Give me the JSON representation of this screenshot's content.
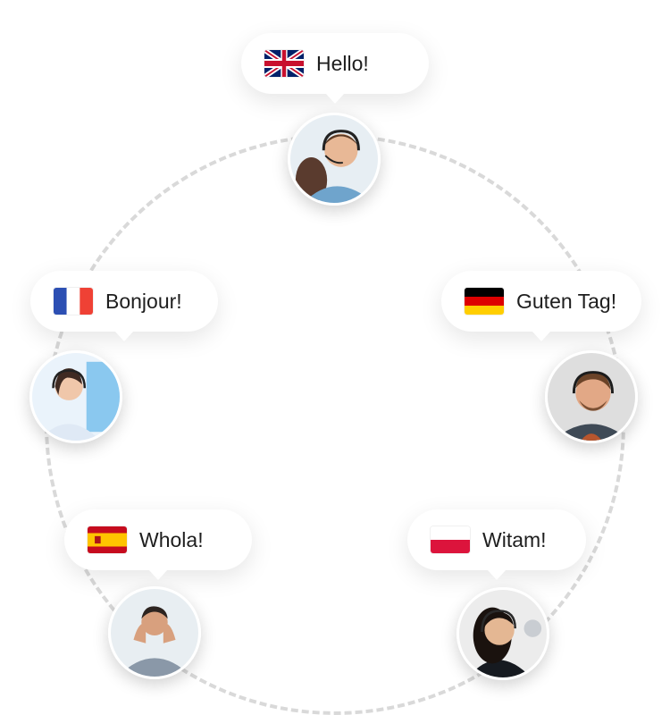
{
  "agents": [
    {
      "language": "English",
      "greeting": "Hello!",
      "flag_icon": "uk-flag-icon"
    },
    {
      "language": "French",
      "greeting": "Bonjour!",
      "flag_icon": "france-flag-icon"
    },
    {
      "language": "German",
      "greeting": "Guten Tag!",
      "flag_icon": "germany-flag-icon"
    },
    {
      "language": "Spanish",
      "greeting": "Whola!",
      "flag_icon": "spain-flag-icon"
    },
    {
      "language": "Polish",
      "greeting": "Witam!",
      "flag_icon": "poland-flag-icon"
    }
  ],
  "colors": {
    "ring": "#d9d9d9",
    "bubble": "#ffffff",
    "text": "#1e1e1e"
  }
}
